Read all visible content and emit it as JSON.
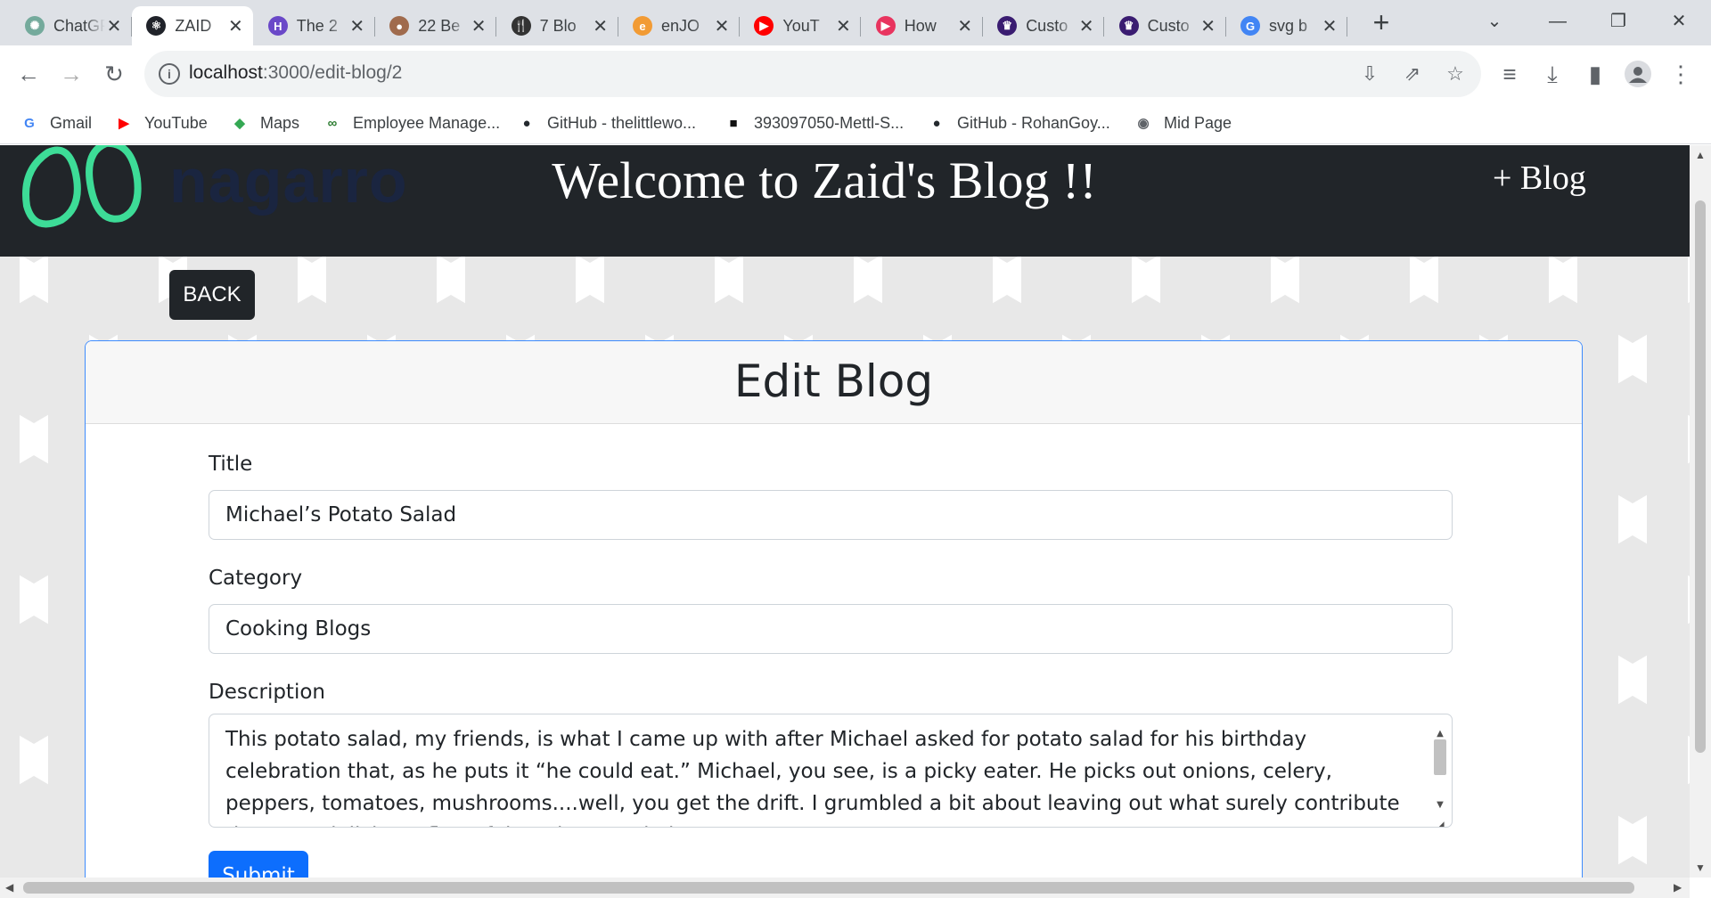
{
  "browser": {
    "tabs": [
      {
        "title": "ChatGPT",
        "icon": "chatgpt-icon",
        "color": "#74aa9c"
      },
      {
        "title": "ZAID",
        "icon": "react-icon",
        "color": "#20232a",
        "active": true
      },
      {
        "title": "The 2",
        "icon": "hashnode-icon",
        "color": "#6a48c8"
      },
      {
        "title": "22 Be",
        "icon": "avatar-icon",
        "color": "#a06b4d"
      },
      {
        "title": "7 Blo",
        "icon": "fork-knife-icon",
        "color": "#333333"
      },
      {
        "title": "enJO",
        "icon": "enjoy-icon",
        "color": "#f29b34"
      },
      {
        "title": "YouT",
        "icon": "youtube-icon",
        "color": "#ff0000"
      },
      {
        "title": "How",
        "icon": "play-icon",
        "color": "#e8345f"
      },
      {
        "title": "Custo",
        "icon": "crown-icon",
        "color": "#3a1c71"
      },
      {
        "title": "Custo",
        "icon": "crown-icon",
        "color": "#3a1c71"
      },
      {
        "title": "svg b",
        "icon": "google-icon",
        "color": "#4285f4"
      }
    ],
    "url_host": "localhost",
    "url_path": ":3000/edit-blog/2",
    "bookmarks": [
      {
        "label": "Gmail",
        "icon": "google-icon",
        "color": "#4285f4"
      },
      {
        "label": "YouTube",
        "icon": "youtube-icon",
        "color": "#ff0000"
      },
      {
        "label": "Maps",
        "icon": "maps-icon",
        "color": "#34a853"
      },
      {
        "label": "Employee Manage...",
        "icon": "employee-icon",
        "color": "#2e7d32"
      },
      {
        "label": "GitHub - thelittlewo...",
        "icon": "github-icon",
        "color": "#24292e"
      },
      {
        "label": "393097050-Mettl-S...",
        "icon": "mettl-icon",
        "color": "#111111"
      },
      {
        "label": "GitHub - RohanGoy...",
        "icon": "github-icon",
        "color": "#24292e"
      },
      {
        "label": "Mid Page",
        "icon": "globe-icon",
        "color": "#5f6368"
      }
    ]
  },
  "site": {
    "logo_text": "nagarro",
    "title": "Welcome to Zaid's Blog !!",
    "add_blog": "+ Blog",
    "back": "BACK"
  },
  "form": {
    "heading": "Edit Blog",
    "title_label": "Title",
    "title_value": "Michael’s Potato Salad",
    "category_label": "Category",
    "category_value": "Cooking Blogs",
    "description_label": "Description",
    "description_value": " This potato salad, my friends, is what I came up with after Michael asked for potato salad for his birthday celebration that, as he puts it “he could eat.” Michael, you see, is a picky eater. He picks out onions, celery, peppers, tomatoes, mushrooms....well, you get the drift. I grumbled a bit about leaving out what surely contribute the most delicious, flavorful, and textural elements",
    "submit": "Submit"
  },
  "colors": {
    "navbar": "#212529",
    "card_border": "#3d8bfd",
    "submit": "#0d6efd",
    "logo_accent": "#3ddc97"
  }
}
